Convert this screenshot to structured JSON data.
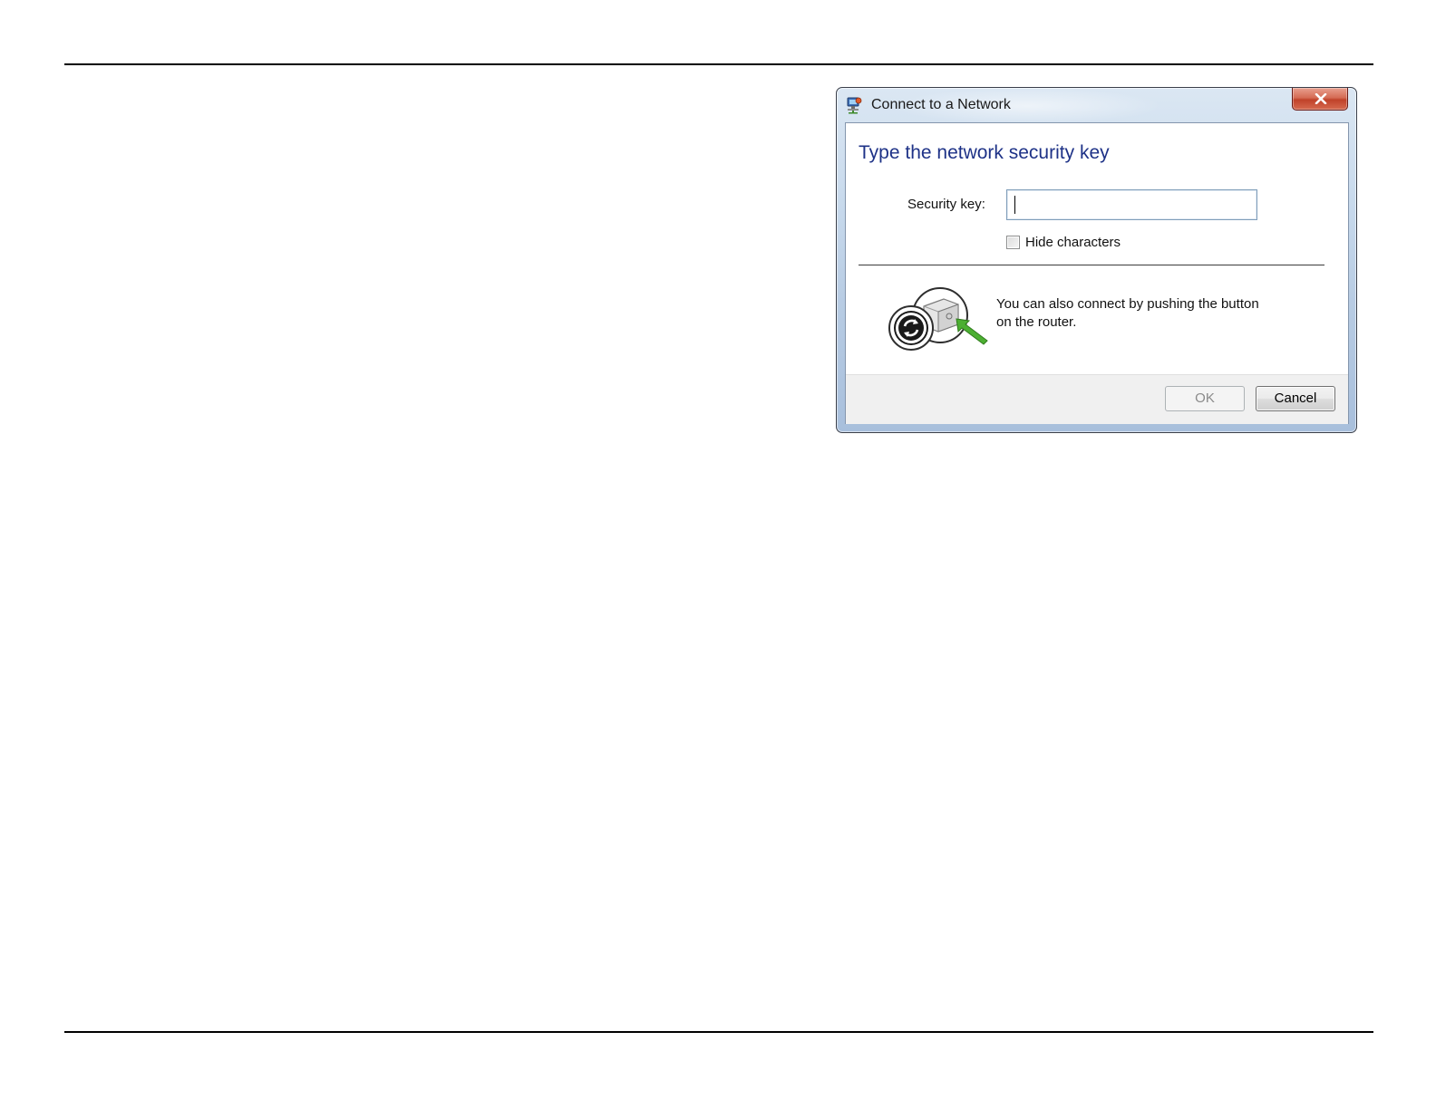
{
  "window": {
    "title": "Connect to a Network",
    "close_label": "X"
  },
  "dialog": {
    "heading": "Type the network security key",
    "security_key_label": "Security key:",
    "security_key_value": "",
    "hide_characters_label": "Hide characters",
    "hide_characters_checked": false,
    "wps_text": "You can also connect by pushing the button on the router."
  },
  "buttons": {
    "ok_label": "OK",
    "ok_enabled": false,
    "cancel_label": "Cancel"
  },
  "icons": {
    "title": "network-icon",
    "close": "close-icon",
    "wps": "wps-router-button-icon"
  },
  "colors": {
    "heading": "#1e3287",
    "close_button": "#c0422a",
    "arrow": "#4caf32"
  }
}
